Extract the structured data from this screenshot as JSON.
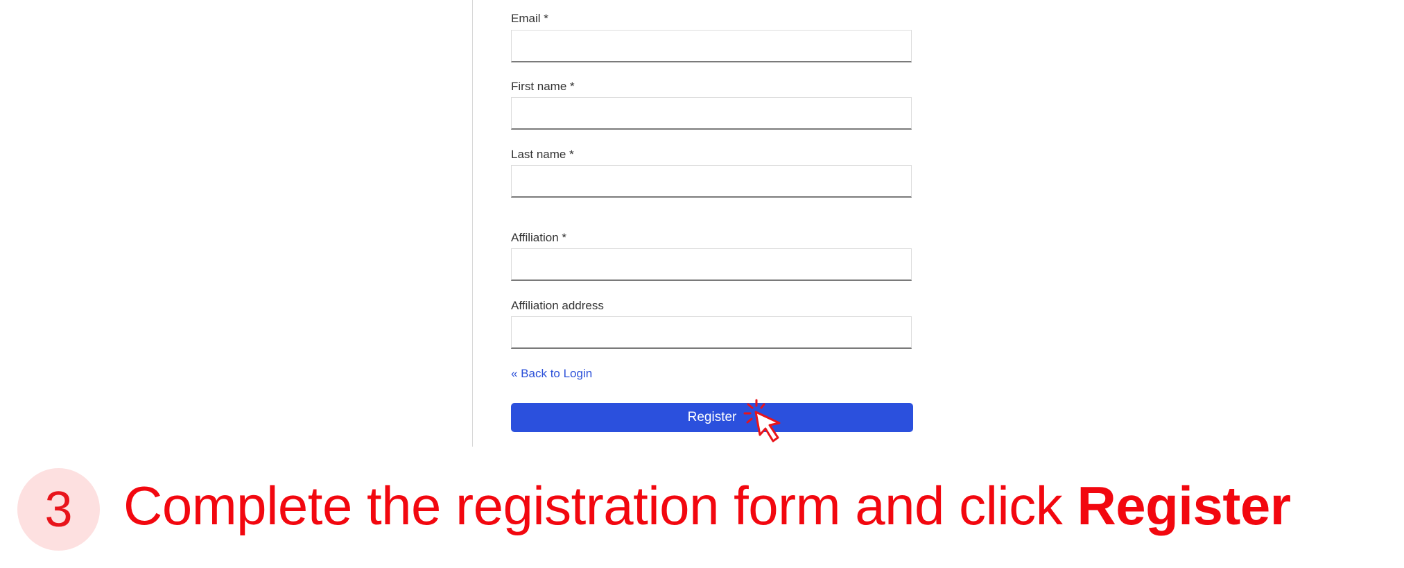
{
  "form": {
    "fields": [
      {
        "label": "Email *",
        "value": ""
      },
      {
        "label": "First name *",
        "value": ""
      },
      {
        "label": "Last name *",
        "value": ""
      },
      {
        "label": "Affiliation *",
        "value": ""
      },
      {
        "label": "Affiliation address",
        "value": ""
      }
    ],
    "back_link": "« Back to Login",
    "register_label": "Register"
  },
  "step": {
    "number": "3",
    "instruction_text": "Complete the registration form and click ",
    "instruction_emphasis": "Register"
  },
  "colors": {
    "accent": "#2b50dd",
    "highlight_red": "#f2070f",
    "step_circle_bg": "#fde0e0"
  },
  "icons": {
    "cursor": "click-cursor-icon"
  }
}
